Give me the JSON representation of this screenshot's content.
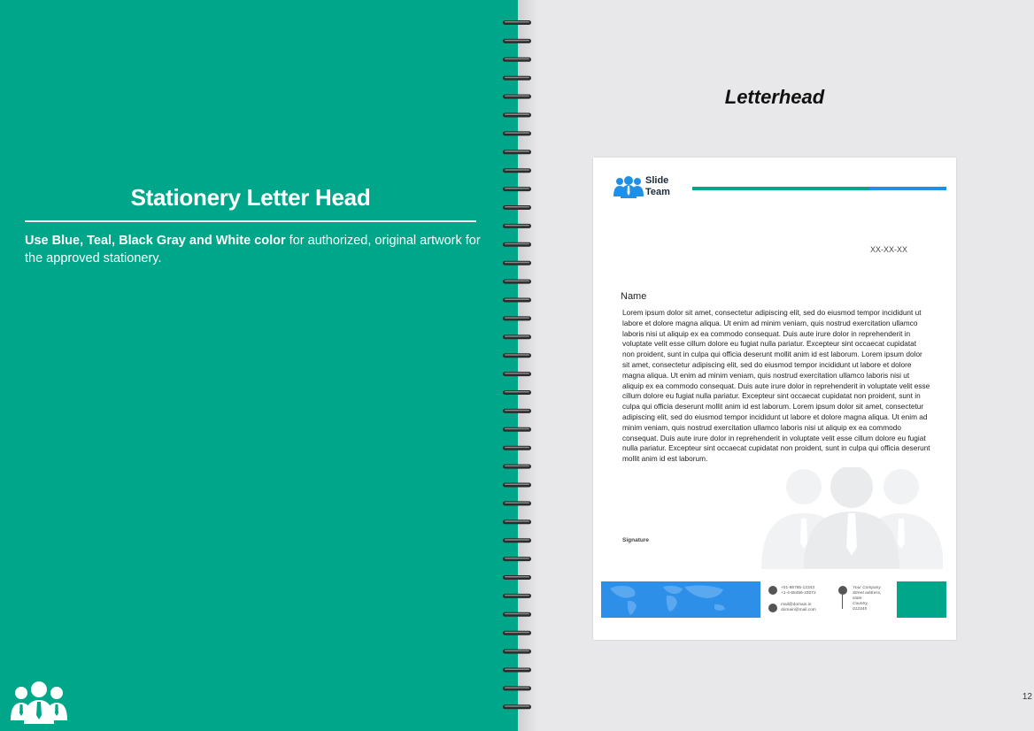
{
  "left_panel": {
    "title": "Stationery Letter Head",
    "description_bold": "Use Blue, Teal, Black Gray and White color",
    "description_rest": " for authorized, original artwork for the approved stationery.",
    "logo_icon": "team-people-icon"
  },
  "right_panel": {
    "title": "Letterhead",
    "page_number": "12"
  },
  "letterhead": {
    "brand_line1": "Slide",
    "brand_line2": "Team",
    "date": "XX-XX-XX",
    "name": "Name",
    "body": "Lorem ipsum dolor sit amet, consectetur adipiscing elit, sed do eiusmod tempor incididunt ut labore et dolore magna aliqua. Ut enim ad minim veniam, quis nostrud exercitation ullamco laboris nisi ut aliquip ex ea commodo consequat. Duis aute irure dolor in reprehenderit in voluptate velit esse cillum dolore eu fugiat nulla pariatur. Excepteur sint occaecat cupidatat non proident, sunt in culpa qui officia deserunt mollit anim id est laborum. Lorem ipsum dolor sit amet, consectetur adipiscing elit, sed do eiusmod tempor incididunt ut labore et dolore magna aliqua. Ut enim ad minim veniam, quis nostrud exercitation ullamco laboris nisi ut aliquip ex ea commodo consequat. Duis aute irure dolor in reprehenderit in voluptate velit esse cillum dolore eu fugiat nulla pariatur. Excepteur sint occaecat cupidatat non proident, sunt in culpa qui officia deserunt mollit anim id est laborum. Lorem ipsum dolor sit amet, consectetur adipiscing elit, sed do eiusmod tempor incididunt ut labore et dolore magna aliqua. Ut enim ad minim veniam, quis nostrud exercitation ullamco laboris nisi ut aliquip ex ea commodo consequat. Duis aute irure dolor in reprehenderit in voluptate velit esse cillum dolore eu fugiat nulla pariatur. Excepteur sint occaecat cupidatat non proident, sunt in culpa qui officia deserunt mollit anim id est laborum.",
    "signature": "Signature",
    "phone1": "+01-86765-12343",
    "phone2": "+1-4-65456-23072",
    "email1": "mail@domain.in",
    "email2": "domain@mail.com",
    "address_line1": "Your Company",
    "address_line2": "Street address,",
    "address_line3": "state",
    "address_line4": "Country,",
    "address_line5": "012345"
  },
  "colors": {
    "teal": "#00a68a",
    "blue": "#1e90e8",
    "gray": "#e6e6e8",
    "white": "#ffffff"
  }
}
